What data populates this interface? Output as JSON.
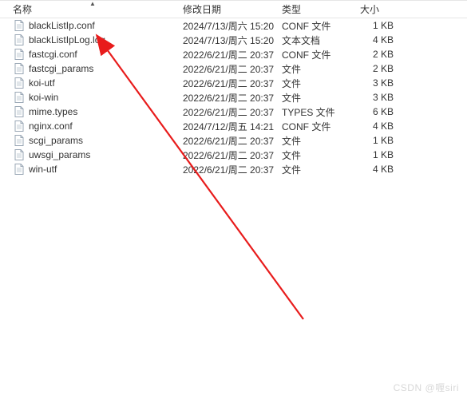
{
  "columns": {
    "name": "名称",
    "date": "修改日期",
    "type": "类型",
    "size": "大小"
  },
  "files": [
    {
      "name": "blackListIp.conf",
      "date": "2024/7/13/周六 15:20",
      "type": "CONF 文件",
      "size": "1 KB"
    },
    {
      "name": "blackListIpLog.log",
      "date": "2024/7/13/周六 15:20",
      "type": "文本文档",
      "size": "4 KB"
    },
    {
      "name": "fastcgi.conf",
      "date": "2022/6/21/周二 20:37",
      "type": "CONF 文件",
      "size": "2 KB"
    },
    {
      "name": "fastcgi_params",
      "date": "2022/6/21/周二 20:37",
      "type": "文件",
      "size": "2 KB"
    },
    {
      "name": "koi-utf",
      "date": "2022/6/21/周二 20:37",
      "type": "文件",
      "size": "3 KB"
    },
    {
      "name": "koi-win",
      "date": "2022/6/21/周二 20:37",
      "type": "文件",
      "size": "3 KB"
    },
    {
      "name": "mime.types",
      "date": "2022/6/21/周二 20:37",
      "type": "TYPES 文件",
      "size": "6 KB"
    },
    {
      "name": "nginx.conf",
      "date": "2024/7/12/周五 14:21",
      "type": "CONF 文件",
      "size": "4 KB"
    },
    {
      "name": "scgi_params",
      "date": "2022/6/21/周二 20:37",
      "type": "文件",
      "size": "1 KB"
    },
    {
      "name": "uwsgi_params",
      "date": "2022/6/21/周二 20:37",
      "type": "文件",
      "size": "1 KB"
    },
    {
      "name": "win-utf",
      "date": "2022/6/21/周二 20:37",
      "type": "文件",
      "size": "4 KB"
    }
  ],
  "watermark": "CSDN @喱siri"
}
